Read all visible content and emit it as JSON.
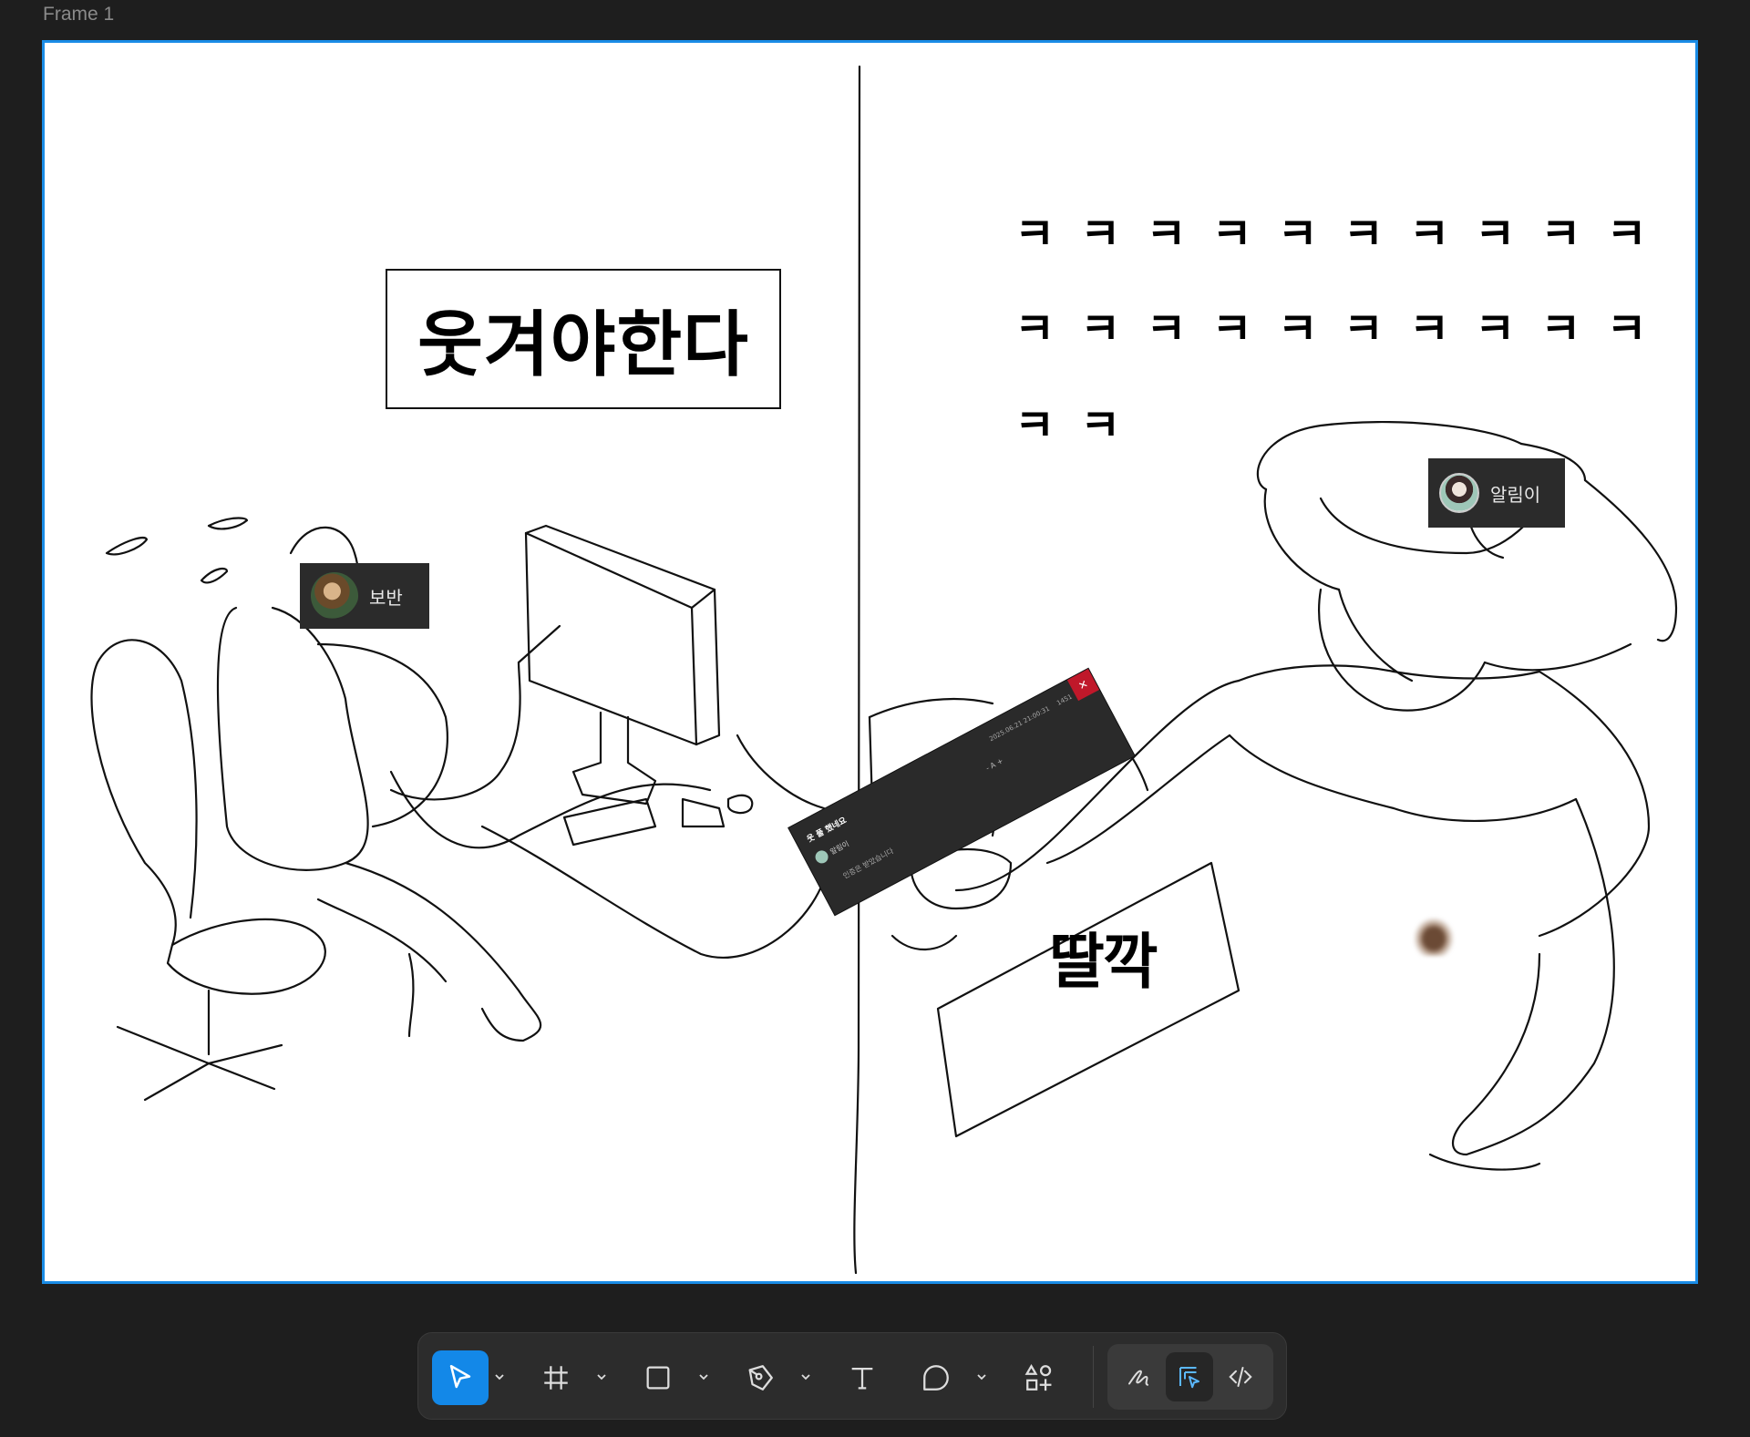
{
  "canvas": {
    "frame_label": "Frame 1"
  },
  "comic": {
    "title_box_text": "웃겨야한다",
    "laugh_lines": [
      "ㅋㅋㅋㅋㅋㅋㅋㅋㅋㅋ",
      "ㅋㅋㅋㅋㅋㅋㅋㅋㅋㅋ",
      "ㅋㅋ"
    ],
    "sound_effect": "딸깍"
  },
  "cursors": {
    "left_user": "보반",
    "right_user": "알림이"
  },
  "popup": {
    "title": "웃 풀 했네요",
    "author": "알림이",
    "date": "2025.06.21 21:00:31",
    "views": "1451",
    "font_controls": "- A +",
    "body": "인증은 받았습니다",
    "close": "✕"
  },
  "toolbar": {
    "tools": [
      {
        "name": "move",
        "icon": "cursor-arrow-icon",
        "active": true,
        "has_menu": true
      },
      {
        "name": "frame",
        "icon": "frame-grid-icon",
        "active": false,
        "has_menu": true
      },
      {
        "name": "shape",
        "icon": "rectangle-icon",
        "active": false,
        "has_menu": true
      },
      {
        "name": "pen",
        "icon": "pen-tool-icon",
        "active": false,
        "has_menu": true
      },
      {
        "name": "text",
        "icon": "text-icon",
        "active": false,
        "has_menu": false
      },
      {
        "name": "comment",
        "icon": "comment-bubble-icon",
        "active": false,
        "has_menu": true
      },
      {
        "name": "actions",
        "icon": "assets-icon",
        "active": false,
        "has_menu": false
      }
    ],
    "modes": [
      {
        "name": "draw",
        "icon": "pencil-scribble-icon",
        "selected": false
      },
      {
        "name": "design",
        "icon": "design-mode-icon",
        "selected": true
      },
      {
        "name": "dev",
        "icon": "code-icon",
        "selected": false
      }
    ],
    "accent_color": "#1388e8"
  }
}
